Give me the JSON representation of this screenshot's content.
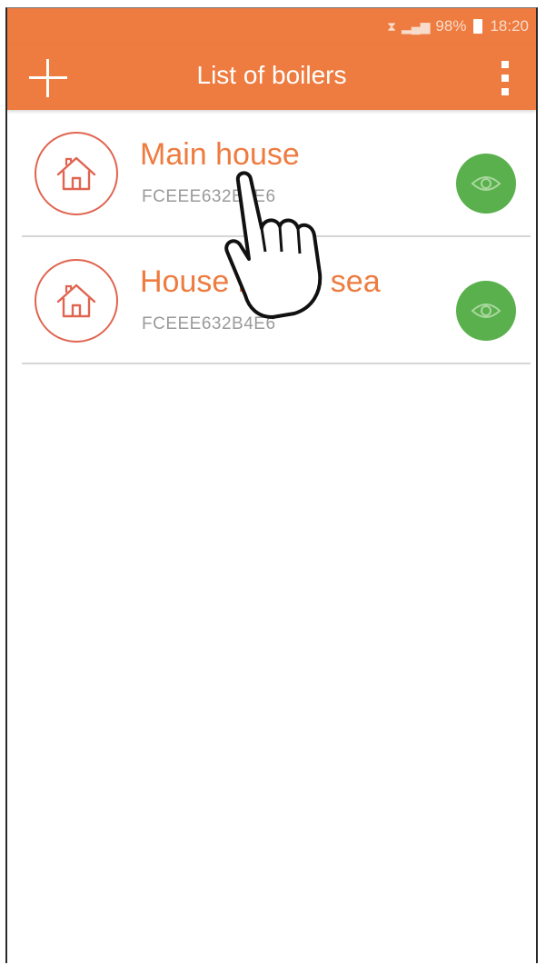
{
  "status_bar": {
    "battery": "98%",
    "time": "18:20"
  },
  "app_bar": {
    "title": "List of boilers",
    "add_icon": "plus-icon",
    "menu_icon": "more-vertical-icon"
  },
  "boilers": [
    {
      "name": "Main house",
      "serial": "FCEEE632B4E6",
      "icon": "house-icon",
      "action_icon": "eye-icon"
    },
    {
      "name": "House by the sea",
      "serial": "FCEEE632B4E6",
      "icon": "house-icon",
      "action_icon": "eye-icon"
    }
  ],
  "colors": {
    "accent": "#ee7b3f",
    "view_button": "#5ab04d",
    "avatar_ring": "#e06450"
  }
}
